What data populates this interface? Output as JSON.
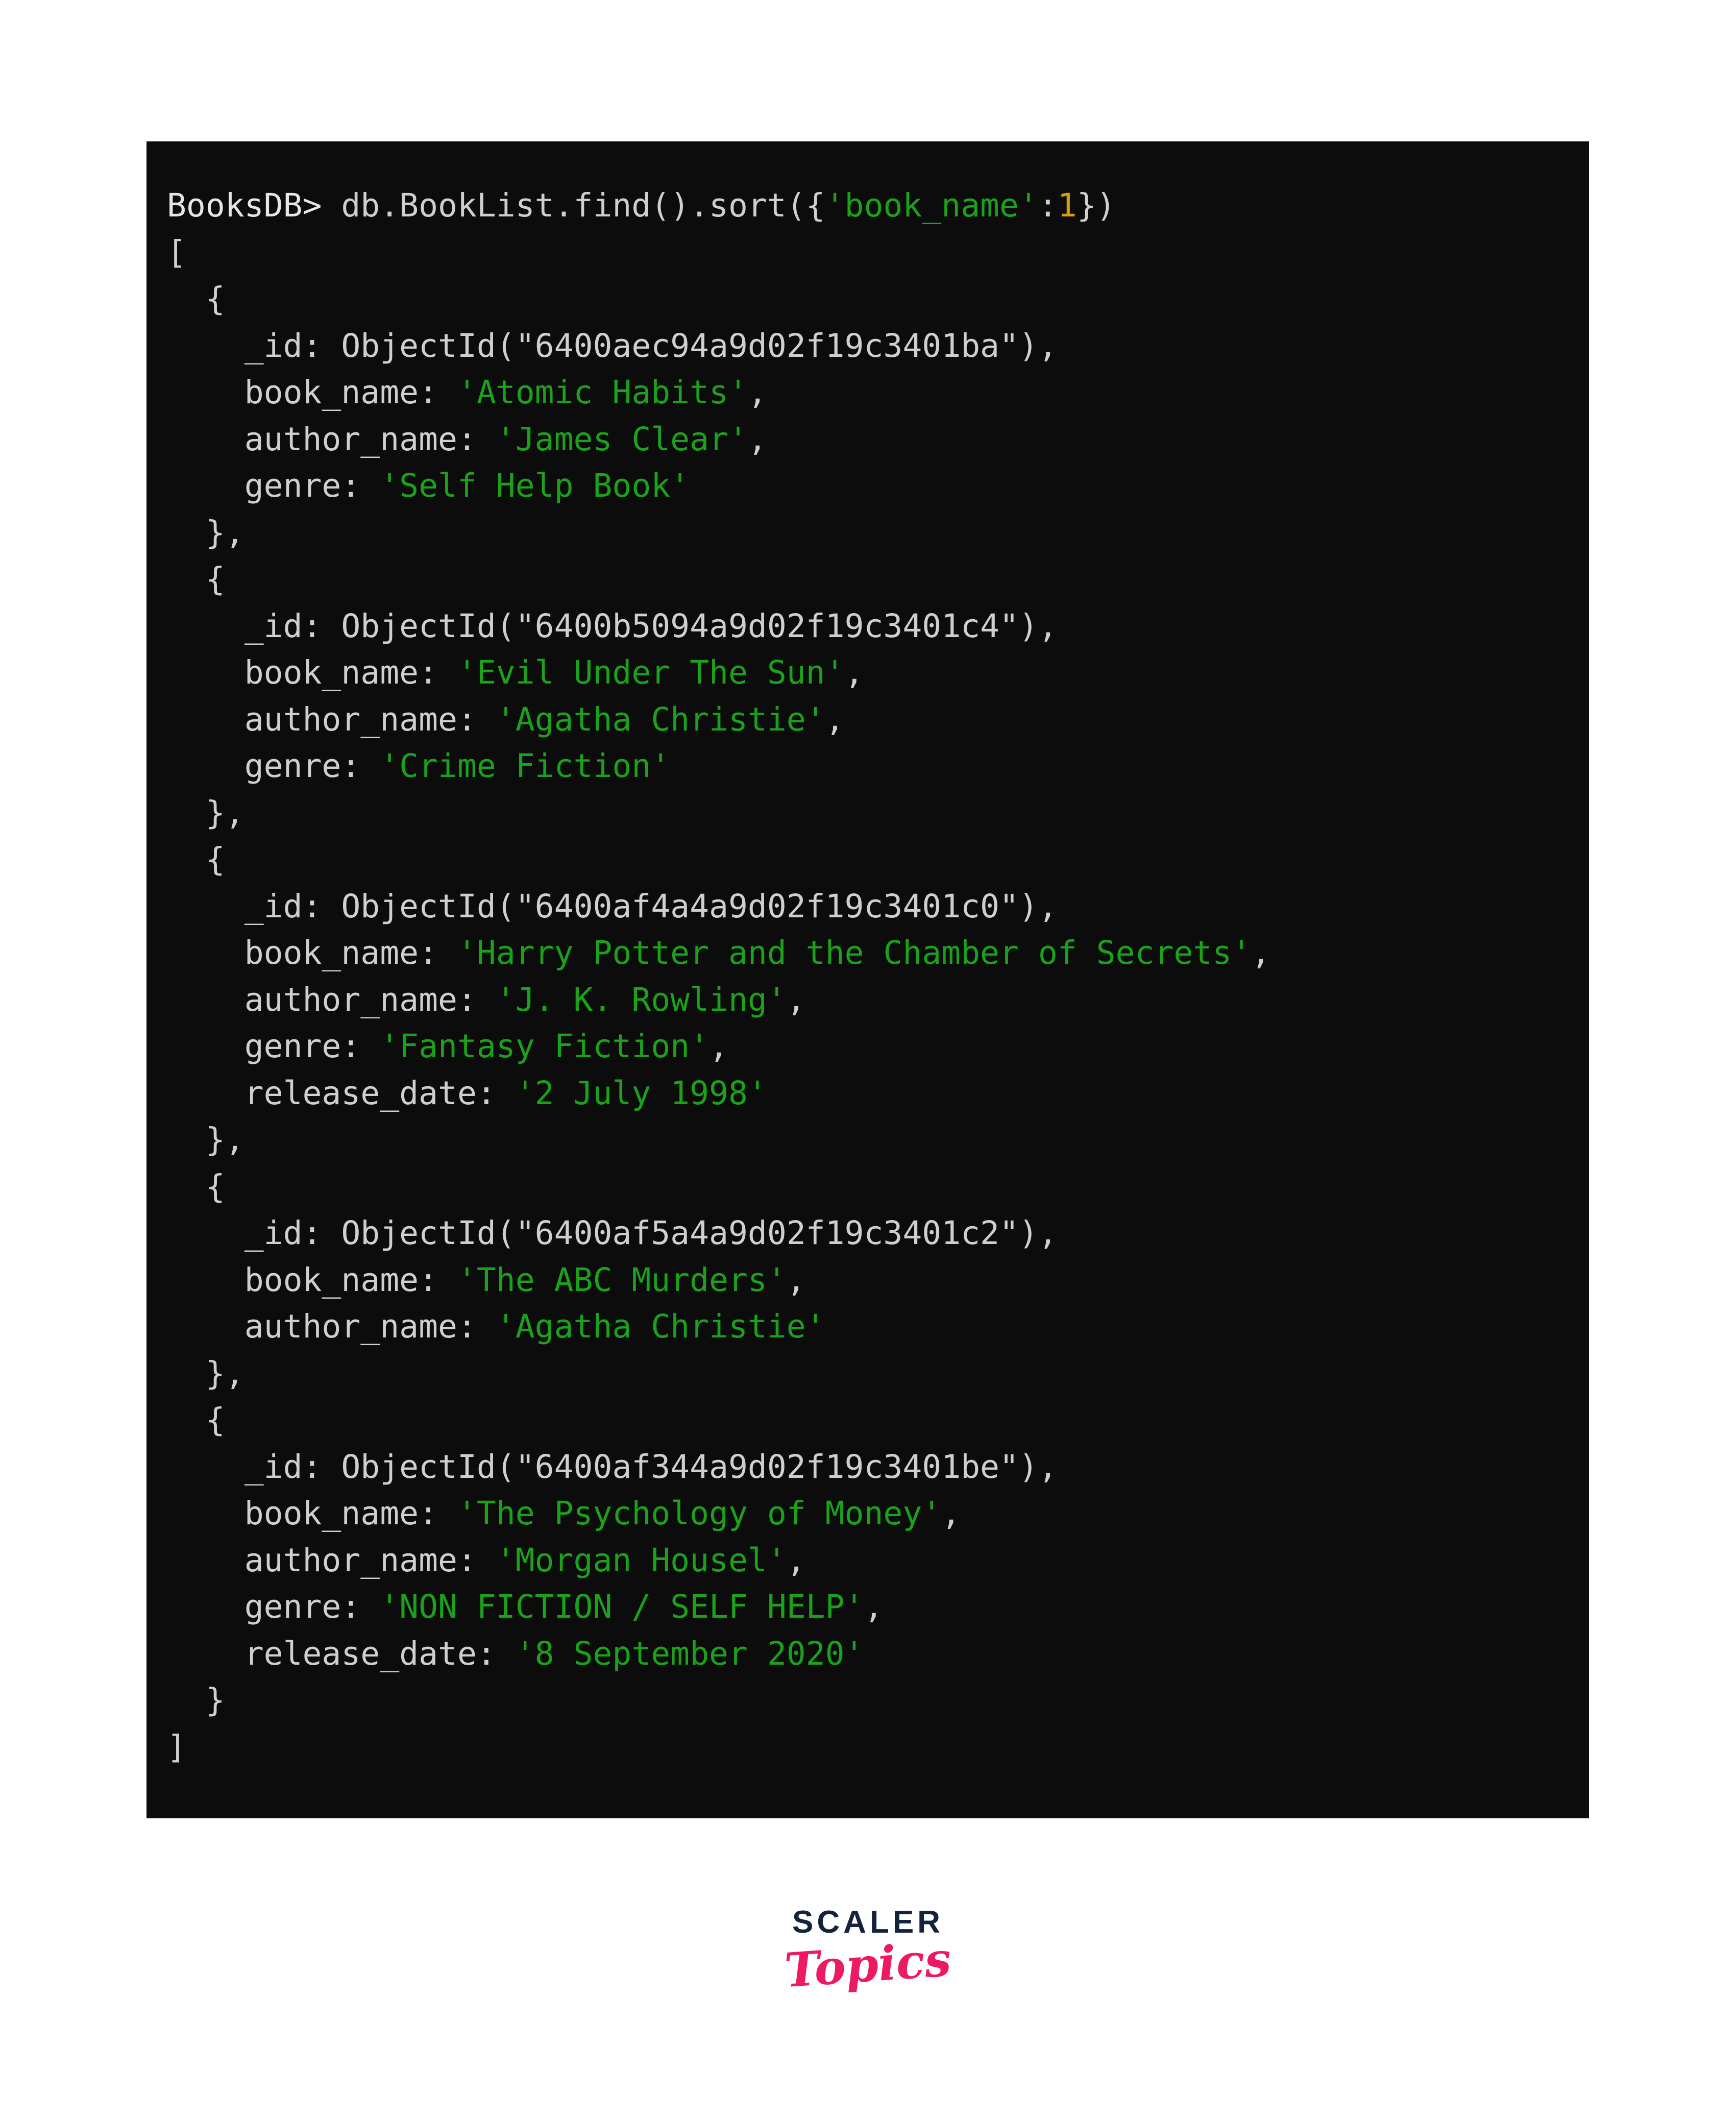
{
  "terminal": {
    "prompt": {
      "db": "BooksDB>",
      "command_prefix": " db.BookList.find().sort({",
      "sort_field": "'book_name'",
      "colon": ":",
      "sort_order": "1",
      "command_suffix": "})"
    },
    "open_bracket": "[",
    "close_bracket": "]",
    "open_brace": "{",
    "close_brace_comma": "},",
    "close_brace": "}",
    "keys": {
      "id": "_id:",
      "book_name": "book_name:",
      "author_name": "author_name:",
      "genre": "genre:",
      "release_date": "release_date:"
    },
    "objectid_open": "ObjectId(",
    "objectid_close": "),",
    "documents": [
      {
        "id": "\"6400aec94a9d02f19c3401ba\"",
        "book_name": "'Atomic Habits'",
        "author_name": "'James Clear'",
        "genre": "'Self Help Book'",
        "release_date": null
      },
      {
        "id": "\"6400b5094a9d02f19c3401c4\"",
        "book_name": "'Evil Under The Sun'",
        "author_name": "'Agatha Christie'",
        "genre": "'Crime Fiction'",
        "release_date": null
      },
      {
        "id": "\"6400af4a4a9d02f19c3401c0\"",
        "book_name": "'Harry Potter and the Chamber of Secrets'",
        "author_name": "'J. K. Rowling'",
        "genre": "'Fantasy Fiction'",
        "release_date": "'2 July 1998'"
      },
      {
        "id": "\"6400af5a4a9d02f19c3401c2\"",
        "book_name": "'The ABC Murders'",
        "author_name": "'Agatha Christie'",
        "genre": null,
        "release_date": null
      },
      {
        "id": "\"6400af344a9d02f19c3401be\"",
        "book_name": "'The Psychology of Money'",
        "author_name": "'Morgan Housel'",
        "genre": "'NON FICTION / SELF HELP'",
        "release_date": "'8 September 2020'"
      }
    ]
  },
  "logo": {
    "scaler": "SCALER",
    "topics": "Topics",
    "scaler_color": "#15223b",
    "topics_color": "#ec1a64"
  },
  "colors": {
    "terminal_background": "#0c0c0c",
    "page_background": "#ffffff",
    "text": "#cfcfcf",
    "string": "#1ba21b",
    "number": "#d7a006"
  }
}
